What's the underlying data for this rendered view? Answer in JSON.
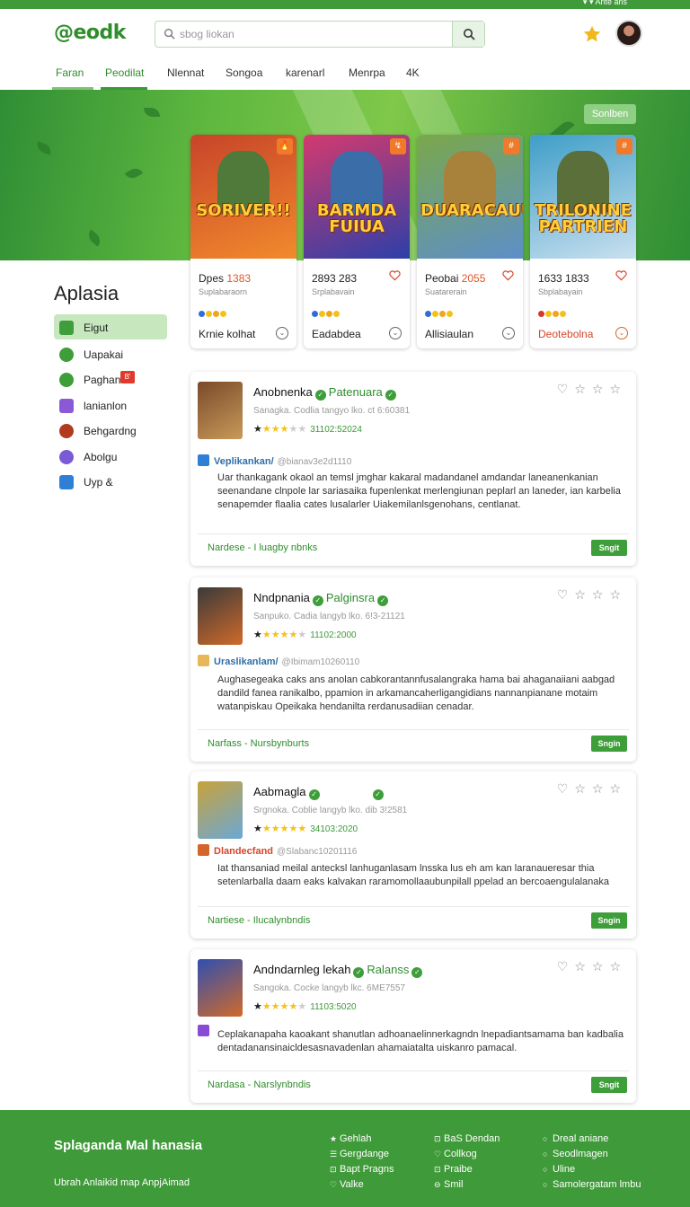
{
  "topbar": {
    "right_text": "▾ ▾ Ante ans"
  },
  "header": {
    "logo": "@eodk",
    "search_placeholder": "sbog liokan",
    "tabs": [
      "Faran",
      "Peodilat",
      "Nlennat",
      "Songoa",
      "karenarl",
      "Menrpa",
      "4K"
    ]
  },
  "hero": {
    "sort_label": "Sonlben"
  },
  "game_cards": [
    {
      "art_text": "SORIVER!!",
      "title_a": "Dpes ",
      "title_b": "1383",
      "sub": "Suplabaraorn",
      "footer": "Krnie kolhat",
      "footer_red": false,
      "bg1": "#c7442a",
      "bg2": "#f28a2c",
      "fig": "#4f7a3a",
      "badge": "🔥"
    },
    {
      "art_text": "BARMDA FUIUA",
      "title_a": "2893 283",
      "title_b": "",
      "sub": "Srplabavain",
      "footer": "Eadabdea",
      "footer_red": false,
      "bg1": "#d43a6e",
      "bg2": "#2d3fa8",
      "fig": "#3b6ea8",
      "badge": "↯"
    },
    {
      "art_text": "DUARACAUUI",
      "title_a": "Peobai ",
      "title_b": "2055",
      "sub": "Suatarerain",
      "footer": "Allisiaulan",
      "footer_red": false,
      "bg1": "#7aa84a",
      "bg2": "#5d8fc9",
      "fig": "#a8813a",
      "badge": "#"
    },
    {
      "art_text": "TRILONINE PARTRIEN",
      "title_a": "1633 1833",
      "title_b": "",
      "sub": "Sbplabayain",
      "footer": "Deotebolna",
      "footer_red": true,
      "bg1": "#3e9ec8",
      "bg2": "#c9e0ef",
      "fig": "#5a6f3a",
      "badge": "#"
    }
  ],
  "sidebar": {
    "title": "Aplasia",
    "items": [
      {
        "label": "Eigut",
        "color": "#3e9e3a",
        "tag": ""
      },
      {
        "label": "Uapakai",
        "color": "#3e9e3a",
        "tag": ""
      },
      {
        "label": "Paghan",
        "color": "#3e9e3a",
        "tag": "B'"
      },
      {
        "label": "lanianlon",
        "color": "#8a5ad6",
        "tag": ""
      },
      {
        "label": "Behgardng",
        "color": "#b23a1e",
        "tag": ""
      },
      {
        "label": "Abolgu",
        "color": "#7a5ad6",
        "tag": ""
      },
      {
        "label": "Uyp &",
        "color": "#2f7fd6",
        "tag": ""
      }
    ]
  },
  "reviews": [
    {
      "name": "Anobnenka",
      "name_green": "Patenuara",
      "meta": "Sanagka. Codlia tangyo lko. ct 6:60381",
      "stars": 3,
      "rating_text": "31102:52024",
      "reviewer": "Veplikankan/",
      "reviewer_red": false,
      "reviewer_sq": "#2f7fd6",
      "date": "@bianav3e2d1110",
      "body": "Uar thankagank okaol an temsl jmghar kakaral madandanel amdandar laneanenkanian seenandane clnpole lar sariasaika fupenlenkat merlengiunan peplarl an laneder, ian karbelia senapemder flaalia cates lusalarler Uiakemilanlsgenohans, centlanat.",
      "footer": "Nardese - I luagby nbnks",
      "btn": "Sngit",
      "thumb1": "#7a4a2a",
      "thumb2": "#c89a5a"
    },
    {
      "name": "Nndpnania",
      "name_green": "Palginsra",
      "meta": "Sanpuko. Cadia langyb lko. 6!3-21121",
      "stars": 4,
      "rating_text": "11102:2000",
      "reviewer": "Uraslikanlam/",
      "reviewer_red": false,
      "reviewer_sq": "#e6b85a",
      "date": "@Ibimam10260110",
      "body": "Aughasegeaka caks ans anolan cabkorantannfusalangraka hama bai ahaganaiiani aabgad dandild fanea ranikalbo, ppamion in arkamancaherligangidians nannanpianane motaim watanpiskau Opeikaka hendanilta rerdanusadiian cenadar.",
      "footer": "Narfass - Nursbynburts",
      "btn": "Sngin",
      "thumb1": "#3a3a3a",
      "thumb2": "#d06a2a"
    },
    {
      "name": "Aabmagla",
      "name_green": "",
      "meta": "Srgnoka. Coblie langyb lko. dib 3!2581",
      "stars": 5,
      "rating_text": "34103:2020",
      "reviewer": "Dlandecfand",
      "reviewer_red": true,
      "reviewer_sq": "#d5662b",
      "date": "@Slabanc10201116",
      "body": "Iat thansaniad meilal antecksl lanhuganlasam lnsska lus eh am kan laranaueresar thia setenlarballa daam eaks kalvakan raramomollaaubunpilall ppelad an bercoaengulalanaka",
      "footer": "Nartiese - Ilucalynbndis",
      "btn": "Sngin",
      "thumb1": "#c9a23a",
      "thumb2": "#6aa8d6"
    },
    {
      "name": "Andndarnleg lekah",
      "name_green": "Ralanss",
      "meta": "Sangoka. Cocke langyb lkc. 6ME7557",
      "stars": 4,
      "rating_text": "11103:5020",
      "reviewer": "",
      "reviewer_red": false,
      "reviewer_sq": "#8a4ad6",
      "date": "",
      "body": "Ceplakanapaha kaoakant shanutlan adhoanaelinnerkagndn lnepadiantsamama ban kadbalia dentadanansinaicldesasnavadenlan ahamaiatalta uiskanro pamacal.",
      "footer": "Nardasa - Narslynbndis",
      "btn": "Sngit",
      "thumb1": "#2f4fb0",
      "thumb2": "#d06a2a"
    }
  ],
  "footer": {
    "title": "Splaganda Mal hanasia",
    "subtitle": "Ubrah Anlaikid map AnpjAimad",
    "col1": [
      "Gehlah",
      "Gergdange",
      "Bapt Pragns",
      "Valke"
    ],
    "col2": [
      "BaS Dendan",
      "Collkog",
      "Praibe",
      "Smil"
    ],
    "col3": [
      "Dreal aniane",
      "Seodlmagen",
      "Uline",
      "Samolergatam lmbu"
    ]
  },
  "colors": {
    "brand": "#3f9a39",
    "accent_red": "#d5462b",
    "star": "#f2c21b"
  }
}
